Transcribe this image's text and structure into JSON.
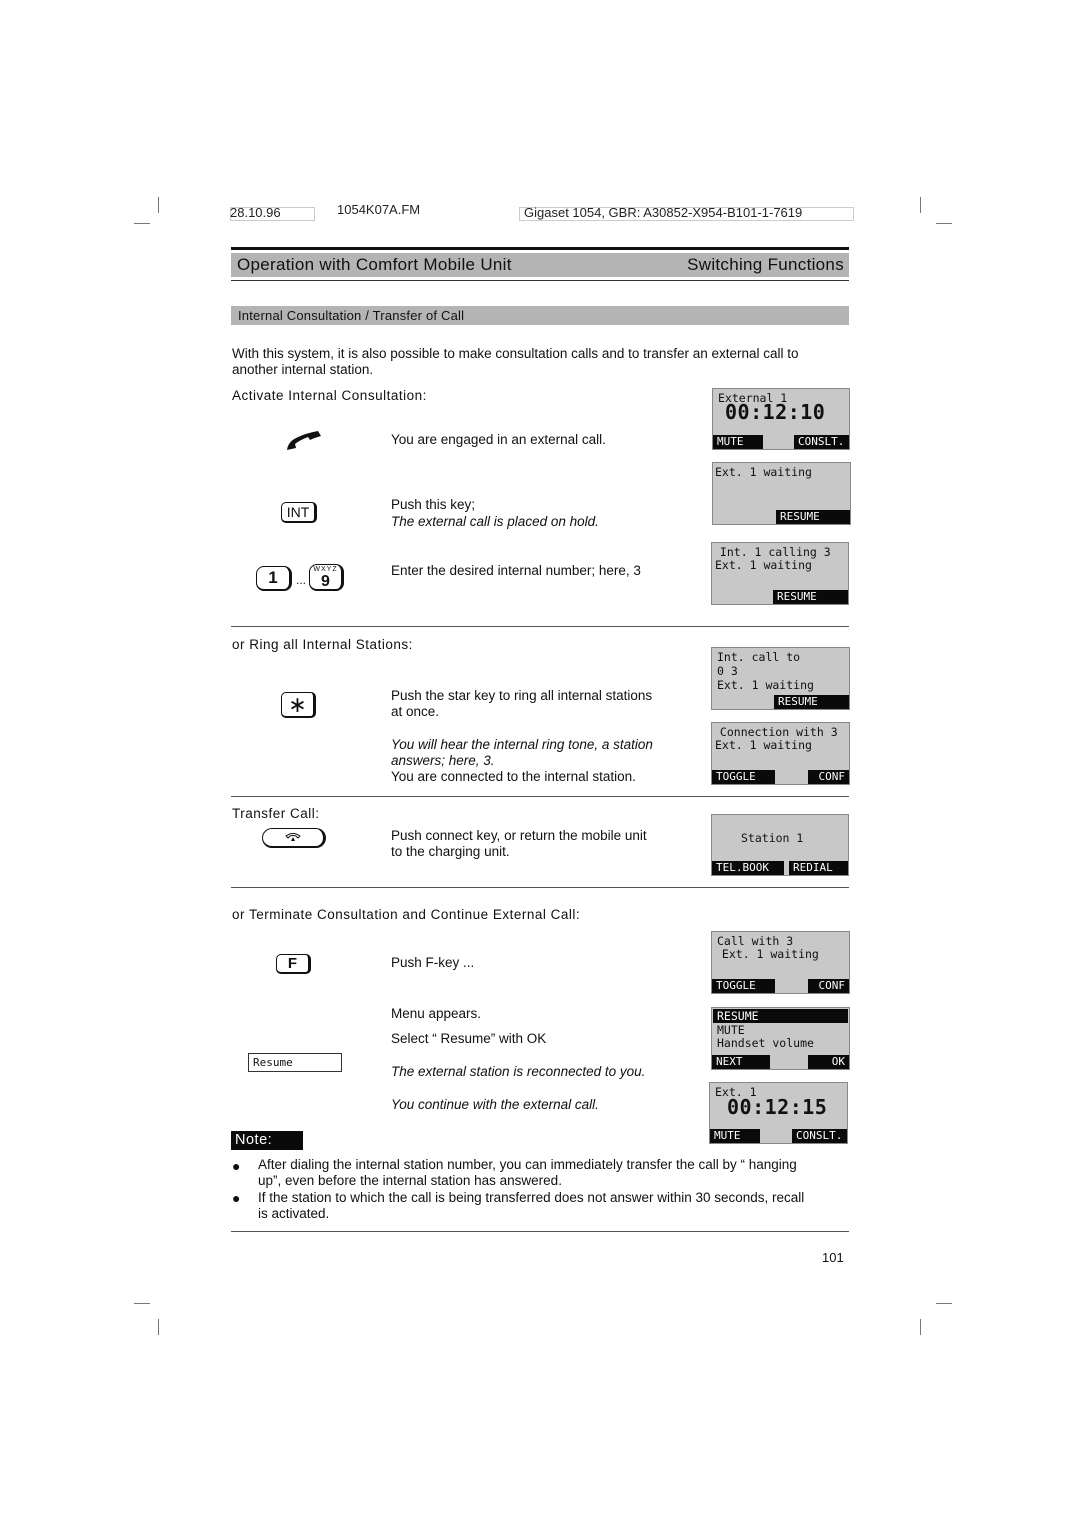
{
  "header": {
    "date": "28.10.96",
    "file": "1054K07A.FM",
    "doc_id": "Gigaset 1054, GBR: A30852-X954-B101-1-7619"
  },
  "title": {
    "left": "Operation with Comfort Mobile Unit",
    "right": "Switching Functions"
  },
  "section": {
    "heading": "Internal Consultation / Transfer of Call",
    "intro_line1": "With this system, it is also possible to make consultation calls and to transfer an external call to",
    "intro_line2": "another internal station."
  },
  "activate": {
    "heading": "Activate Internal Consultation:",
    "steps": [
      {
        "icon": "handset-icon",
        "text": "You are engaged in an external call."
      },
      {
        "key_label": "INT",
        "text": "Push this key;",
        "italic": "The external call is placed on hold."
      },
      {
        "key_from": "1",
        "key_to": "9",
        "key_to_letters": "WXYZ",
        "ellipsis": "...",
        "text": "Enter the desired internal number; here, 3"
      }
    ]
  },
  "ring_all": {
    "heading": "or Ring all Internal Stations:",
    "key_label": "∗",
    "text_line1": "Push the star key to ring all internal  stations",
    "text_line2": "at once.",
    "italic_line1": "You will hear the internal ring tone, a station",
    "italic_line2": "answers; here, 3.",
    "text_after": "You are connected to the internal station."
  },
  "transfer": {
    "heading": "Transfer Call:",
    "text_line1": "Push connect key, or return the mobile unit",
    "text_line2": "to the charging unit."
  },
  "terminate": {
    "heading": "or Terminate Consultation and Continue External Call:",
    "key_label": "F",
    "push_text": "Push F-key ...",
    "menu_text": "Menu appears.",
    "select_text": "Select “ Resume”  with OK",
    "menu_item": "Resume",
    "italic1": "The external station is reconnected to you.",
    "italic2": "You continue with the external call."
  },
  "displays": [
    {
      "lines": [
        "External 1"
      ],
      "big": "00:12:10",
      "softkeys": [
        "MUTE",
        "CONSLT."
      ]
    },
    {
      "lines": [
        "Ext. 1 waiting"
      ],
      "softkeys": [
        "",
        "RESUME"
      ]
    },
    {
      "lines": [
        " Int. 1 calling 3",
        "Ext. 1 waiting"
      ],
      "softkeys": [
        "",
        "RESUME"
      ]
    },
    {
      "lines": [
        "Int. call to",
        "0 3",
        "Ext. 1 waiting"
      ],
      "softkeys": [
        "",
        "RESUME"
      ]
    },
    {
      "lines": [
        " Connection with 3",
        "Ext. 1 waiting"
      ],
      "softkeys": [
        "TOGGLE",
        "CONF"
      ]
    },
    {
      "lines": [
        "Station 1"
      ],
      "softkeys": [
        "TEL.BOOK",
        "REDIAL"
      ]
    },
    {
      "lines": [
        "Call with 3",
        " Ext. 1 waiting"
      ],
      "softkeys": [
        "TOGGLE",
        "CONF"
      ]
    },
    {
      "lines": [
        "RESUME",
        "MUTE",
        "Handset volume"
      ],
      "softkeys": [
        "NEXT",
        "OK"
      ]
    },
    {
      "lines": [
        "Ext. 1"
      ],
      "big": "00:12:15",
      "softkeys": [
        "MUTE",
        "CONSLT."
      ]
    }
  ],
  "note": {
    "label": "Note:",
    "bullet": "●",
    "items": [
      [
        "After dialing the internal station number, you can immediately transfer the call by “ hanging",
        "up”, even before the internal station has answered."
      ],
      [
        "If the station to which the call is being transferred does not answer within 30 seconds, recall",
        "is activated."
      ]
    ]
  },
  "page_number": "101"
}
